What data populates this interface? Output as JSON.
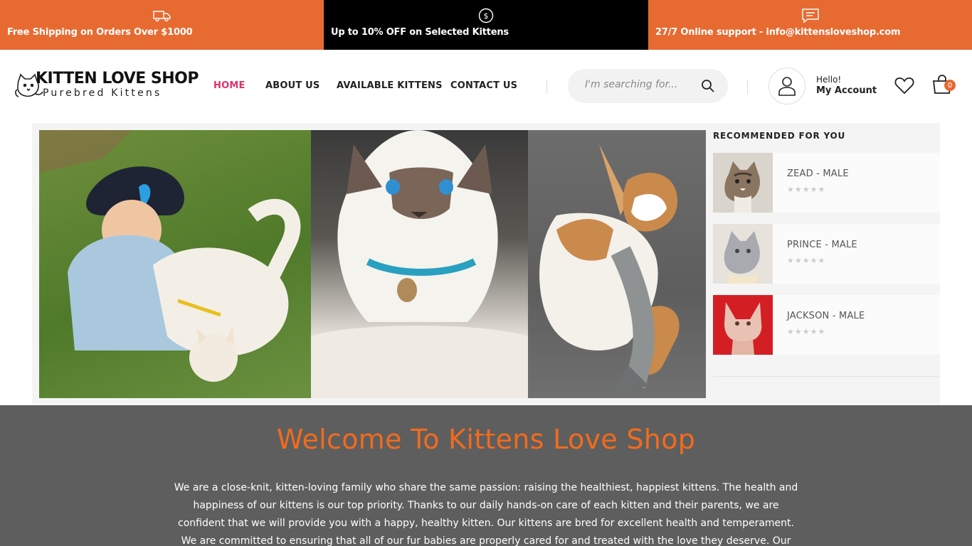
{
  "promo": {
    "shipping": "Free Shipping on Orders Over $1000",
    "discount": "Up to 10% OFF on Selected Kittens",
    "support": "27/7 Online support - info@kittensloveshop.com",
    "shipping_icon": "truck-icon",
    "discount_icon": "dollar-coin-icon",
    "support_icon": "chat-bubble-icon"
  },
  "logo": {
    "brand": "KITTEN LOVE SHOP",
    "tagline": "Purebred Kittens"
  },
  "nav": {
    "items": [
      {
        "label": "HOME",
        "active": true
      },
      {
        "label": "ABOUT US",
        "active": false
      },
      {
        "label": "AVAILABLE KITTENS",
        "active": false
      },
      {
        "label": "CONTACT US",
        "active": false
      }
    ]
  },
  "search": {
    "placeholder": "I'm searching for..."
  },
  "account": {
    "hello": "Hello!",
    "label": "My Account"
  },
  "cart": {
    "count": "0"
  },
  "recommended": {
    "title": "RECOMMENDED FOR YOU",
    "items": [
      {
        "name": "ZEAD - MALE",
        "stars": "★★★★★"
      },
      {
        "name": "PRINCE - MALE",
        "stars": "★★★★★"
      },
      {
        "name": "JACKSON - MALE",
        "stars": "★★★★★"
      }
    ]
  },
  "welcome": {
    "title": "Welcome To Kittens Love Shop",
    "body": "We are a close-knit, kitten-loving family who share the same passion: raising the healthiest, happiest kittens. The health and happiness of our kittens is our top priority. Thanks to our daily hands-on care of each kitten and their parents, we are confident that we will provide you with a happy, healthy kitten. Our kittens are bred for excellent health and temperament. We are committed to ensuring that all of our fur babies are properly cared for and treated with the love they deserve. Our"
  },
  "colors": {
    "accent": "#e76a31",
    "nav_active": "#e0306c",
    "welcome_title": "#f26b1d",
    "welcome_bg": "#5e5e5e"
  }
}
